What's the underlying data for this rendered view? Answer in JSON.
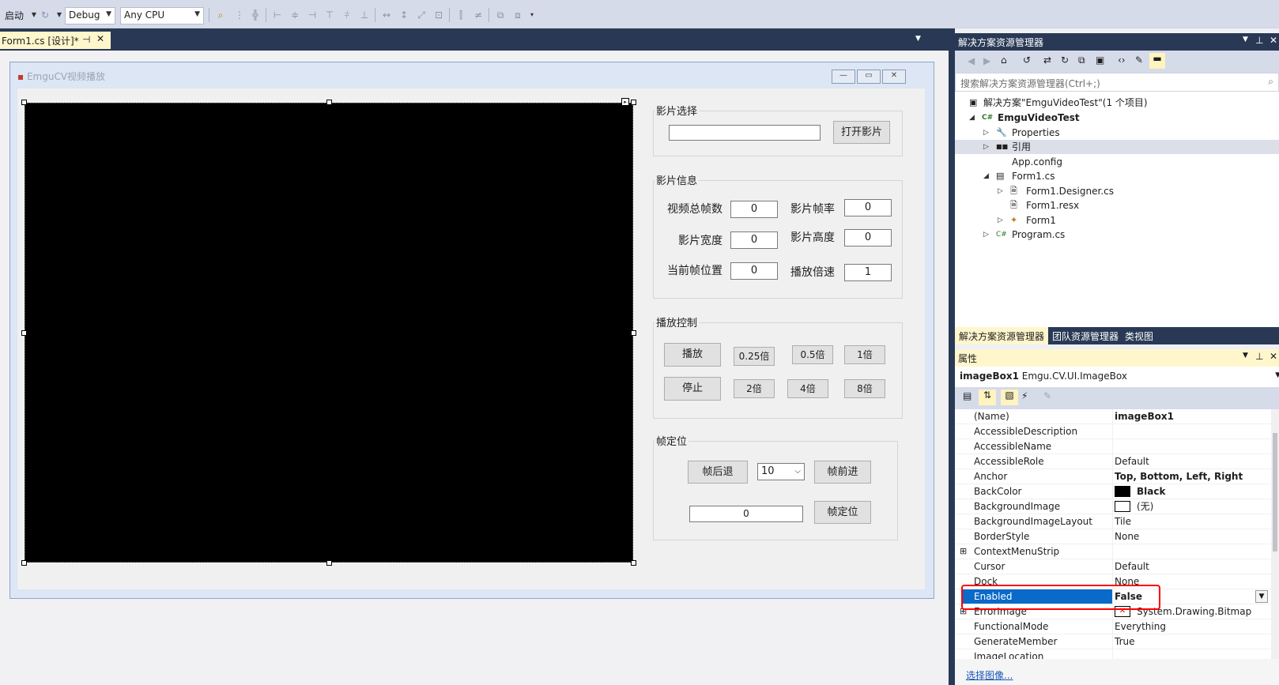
{
  "toolbar": {
    "start_label": "启动",
    "config_value": "Debug",
    "platform_value": "Any CPU"
  },
  "document_tab": {
    "label": "Form1.cs [设计]*"
  },
  "form": {
    "title": "EmguCV视频播放",
    "groups": {
      "select": {
        "title": "影片选择",
        "path_value": "",
        "open_button": "打开影片"
      },
      "info": {
        "title": "影片信息",
        "total_frames_label": "视频总帧数",
        "total_frames_value": "0",
        "fps_label": "影片帧率",
        "fps_value": "0",
        "width_label": "影片宽度",
        "width_value": "0",
        "height_label": "影片高度",
        "height_value": "0",
        "pos_label": "当前帧位置",
        "pos_value": "0",
        "speed_label": "播放倍速",
        "speed_value": "1"
      },
      "playback": {
        "title": "播放控制",
        "play": "播放",
        "stop": "停止",
        "x025": "0.25倍",
        "x05": "0.5倍",
        "x1": "1倍",
        "x2": "2倍",
        "x4": "4倍",
        "x8": "8倍"
      },
      "frame": {
        "title": "帧定位",
        "back": "帧后退",
        "step_value": "10",
        "forward": "帧前进",
        "frame_value": "0",
        "locate": "帧定位"
      }
    }
  },
  "solution_explorer": {
    "title": "解决方案资源管理器",
    "search_placeholder": "搜索解决方案资源管理器(Ctrl+;)",
    "tree": [
      {
        "text": "解决方案\"EmguVideoTest\"(1 个项目)",
        "level": 0,
        "icon": "solution-icon",
        "glyph": "▣",
        "expander": ""
      },
      {
        "text": "EmguVideoTest",
        "level": 0,
        "icon": "csharp-project-icon",
        "glyph": "C#",
        "expander": "◢",
        "bold": true
      },
      {
        "text": "Properties",
        "level": 1,
        "icon": "wrench-icon",
        "glyph": "🔧",
        "expander": "▷"
      },
      {
        "text": "引用",
        "level": 1,
        "icon": "references-icon",
        "glyph": "■■",
        "expander": "▷",
        "selected": true
      },
      {
        "text": "App.config",
        "level": 1,
        "icon": "config-icon",
        "glyph": "",
        "expander": ""
      },
      {
        "text": "Form1.cs",
        "level": 1,
        "icon": "form-icon",
        "glyph": "▤",
        "expander": "◢"
      },
      {
        "text": "Form1.Designer.cs",
        "level": 2,
        "icon": "file-icon",
        "glyph": "🗎",
        "expander": "▷"
      },
      {
        "text": "Form1.resx",
        "level": 2,
        "icon": "resx-icon",
        "glyph": "🗎",
        "expander": ""
      },
      {
        "text": "Form1",
        "level": 2,
        "icon": "class-icon",
        "glyph": "✦",
        "expander": "▷"
      },
      {
        "text": "Program.cs",
        "level": 1,
        "icon": "csharp-file-icon",
        "glyph": "C#",
        "expander": "▷"
      }
    ],
    "tabs": [
      "解决方案资源管理器",
      "团队资源管理器",
      "类视图"
    ]
  },
  "properties": {
    "title": "属性",
    "object_name": "imageBox1",
    "object_type": "Emgu.CV.UI.ImageBox",
    "rows": [
      {
        "name": "(Name)",
        "value": "imageBox1",
        "bold": true
      },
      {
        "name": "AccessibleDescription",
        "value": ""
      },
      {
        "name": "AccessibleName",
        "value": ""
      },
      {
        "name": "AccessibleRole",
        "value": "Default"
      },
      {
        "name": "Anchor",
        "value": "Top, Bottom, Left, Right",
        "bold": true
      },
      {
        "name": "BackColor",
        "value": "Black",
        "bold": true,
        "swatch": "#000000"
      },
      {
        "name": "BackgroundImage",
        "value": "(无)",
        "swatch": "#ffffff"
      },
      {
        "name": "BackgroundImageLayout",
        "value": "Tile"
      },
      {
        "name": "BorderStyle",
        "value": "None"
      },
      {
        "name": "ContextMenuStrip",
        "value": "",
        "expandable": true
      },
      {
        "name": "Cursor",
        "value": "Default"
      },
      {
        "name": "Dock",
        "value": "None"
      },
      {
        "name": "Enabled",
        "value": "False",
        "bold": true,
        "selected": true
      },
      {
        "name": "ErrorImage",
        "value": "System.Drawing.Bitmap",
        "expandable": true,
        "swatch": "#ffffff"
      },
      {
        "name": "FunctionalMode",
        "value": "Everything"
      },
      {
        "name": "GenerateMember",
        "value": "True"
      },
      {
        "name": "ImageLocation",
        "value": ""
      }
    ],
    "footer_link": "选择图像..."
  }
}
